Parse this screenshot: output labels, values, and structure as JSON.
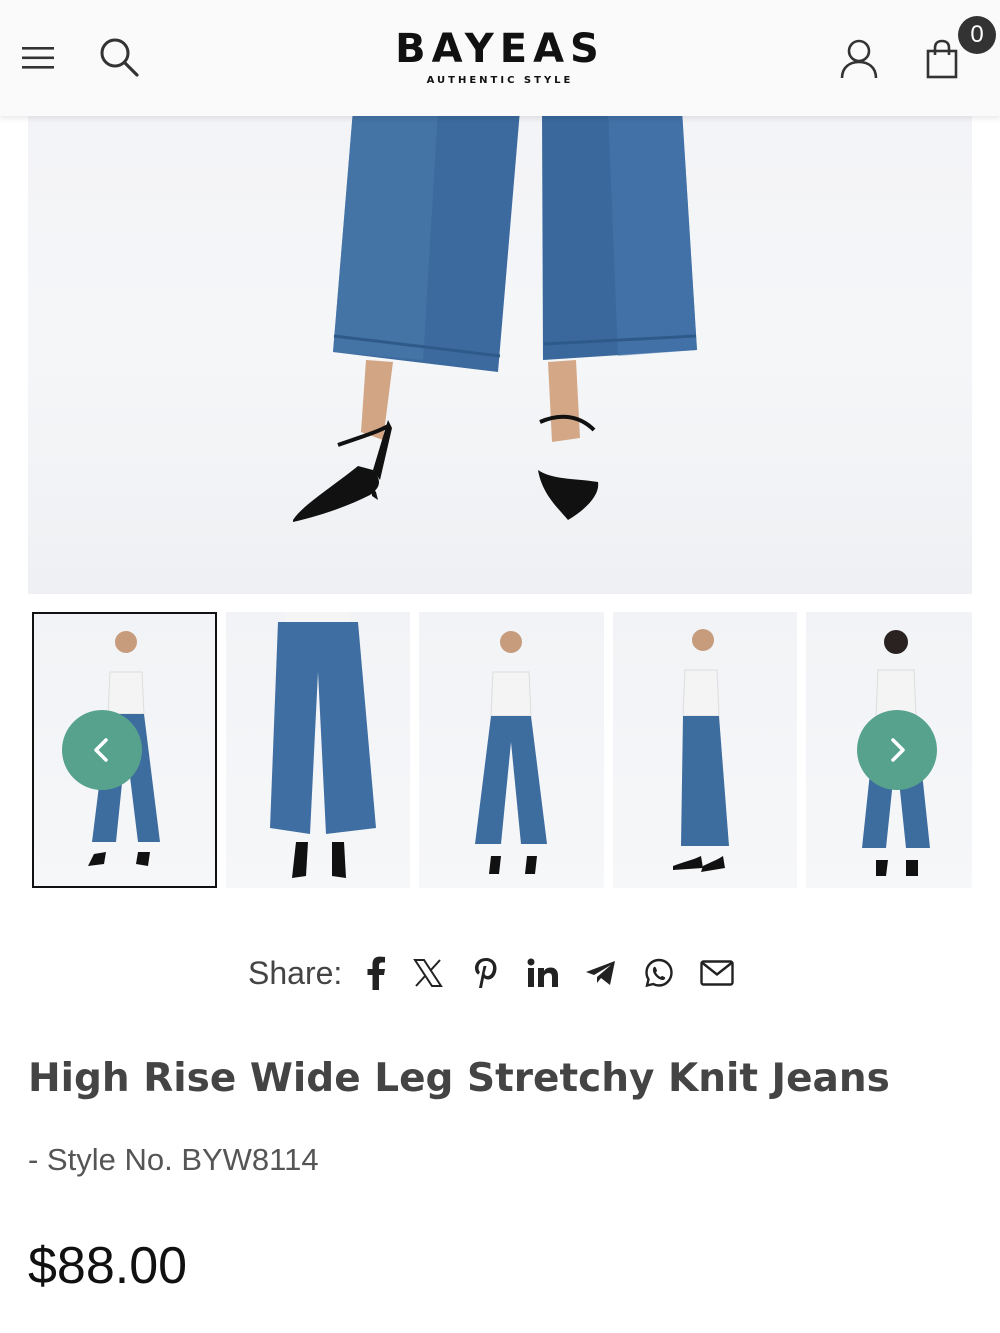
{
  "header": {
    "logo_main": "BAYEAS",
    "logo_sub": "AUTHENTIC STYLE",
    "cart_count": "0"
  },
  "gallery": {
    "thumbnail_count": 5,
    "active_index": 0,
    "accent_color": "#57a28d"
  },
  "share": {
    "label": "Share:",
    "icons": [
      "facebook-icon",
      "x-icon",
      "pinterest-icon",
      "linkedin-icon",
      "telegram-icon",
      "whatsapp-icon",
      "email-icon"
    ]
  },
  "product": {
    "title": "High Rise Wide Leg Stretchy Knit Jeans",
    "style_no": "- Style No. BYW8114",
    "price": "$88.00"
  }
}
